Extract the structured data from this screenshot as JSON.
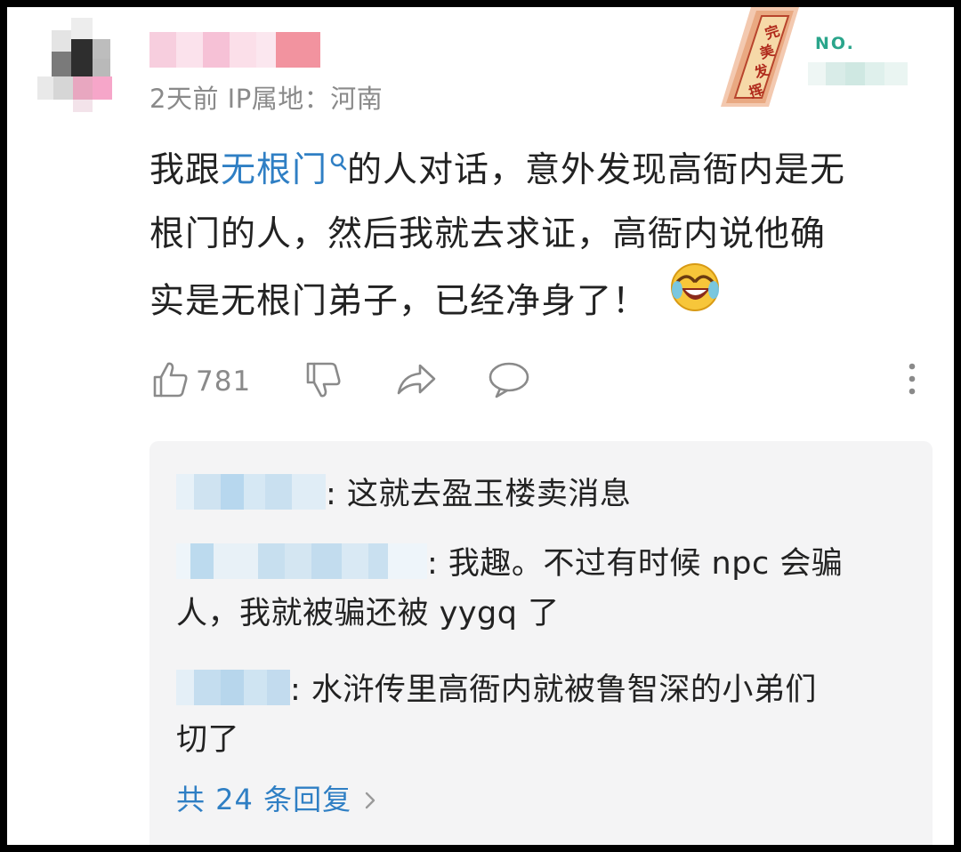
{
  "comment": {
    "meta_text": "2天前  IP属地：河南",
    "badge": {
      "label": "完美发挥",
      "number_prefix": "NO."
    },
    "content": {
      "line1_before": "我跟",
      "line1_link": "无根门",
      "line1_after": "的人对话，意外发现高衙内是无",
      "line2": "根门的人，然后我就去求证，高衙内说他确",
      "line3": "实是无根门弟子，已经净身了！"
    },
    "actions": {
      "like_count": "781"
    },
    "replies": [
      {
        "text": ": 这就去盈玉楼卖消息"
      },
      {
        "text_line1": ": 我趣。不过有时候 npc 会骗",
        "text_line2": "人，我就被骗还被 yygq 了"
      },
      {
        "text_line1": ": 水浒传里高衙内就被鲁智深的小弟们",
        "text_line2": "切了"
      }
    ],
    "more_replies_label": "共 24 条回复"
  },
  "icons": {
    "like": "thumbs-up-icon",
    "dislike": "thumbs-down-icon",
    "share": "share-arrow-icon",
    "comment": "speech-bubble-icon",
    "more": "more-vertical-icon",
    "search": "search-icon",
    "emoji": "laughing-crying-emoji-icon",
    "chevron": "chevron-right-icon"
  },
  "colors": {
    "link": "#2f7fc4",
    "meta": "#8a8a8a",
    "reply_bg": "#f4f4f5",
    "badge_green": "#2aa58b"
  }
}
